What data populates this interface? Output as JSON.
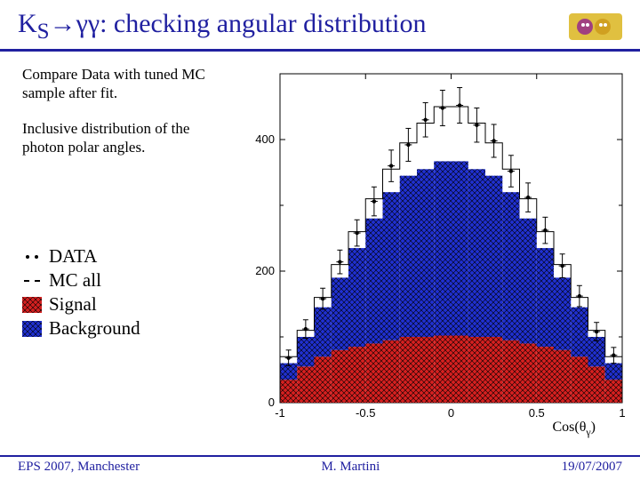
{
  "title_prefix": "K",
  "title_sub": "S",
  "title_arrow": "→γγ",
  "title_rest": ": checking angular distribution",
  "desc1": "Compare Data with tuned MC sample after fit.",
  "desc2": "Inclusive distribution of the photon polar angles.",
  "legend": {
    "data": "DATA",
    "mc": "MC all",
    "signal": "Signal",
    "bkg": "Background"
  },
  "footer": {
    "left": "EPS 2007, Manchester",
    "mid": "M. Martini",
    "right": "19/07/2007"
  },
  "xlabel": "Cos(θ",
  "xlabel_sub": "γ",
  "xlabel_close": ")",
  "chart_data": {
    "type": "bar",
    "xlabel": "Cos(θ_γ)",
    "ylabel": "",
    "xlim": [
      -1.0,
      1.0
    ],
    "ylim": [
      0,
      500
    ],
    "y_ticks": [
      0,
      200,
      400
    ],
    "x_ticks": [
      -1,
      -0.5,
      0,
      0.5,
      1
    ],
    "bin_edges": [
      -1.0,
      -0.9,
      -0.8,
      -0.7,
      -0.6,
      -0.5,
      -0.4,
      -0.3,
      -0.2,
      -0.1,
      0.0,
      0.1,
      0.2,
      0.3,
      0.4,
      0.5,
      0.6,
      0.7,
      0.8,
      0.9,
      1.0
    ],
    "series": [
      {
        "name": "Signal",
        "role": "stacked-bottom",
        "color": "#d62020",
        "values": [
          35,
          55,
          70,
          80,
          85,
          90,
          95,
          100,
          100,
          102,
          102,
          100,
          100,
          95,
          90,
          85,
          80,
          70,
          55,
          35
        ]
      },
      {
        "name": "Background",
        "role": "stacked-top",
        "color": "#2030d0",
        "values": [
          25,
          45,
          75,
          110,
          150,
          190,
          225,
          245,
          255,
          265,
          265,
          255,
          245,
          225,
          190,
          150,
          110,
          75,
          45,
          25
        ]
      },
      {
        "name": "MC all",
        "role": "step-line",
        "values": [
          70,
          110,
          160,
          210,
          260,
          310,
          355,
          395,
          425,
          450,
          450,
          425,
          395,
          355,
          310,
          260,
          210,
          160,
          110,
          70
        ]
      },
      {
        "name": "DATA",
        "role": "points-errors",
        "values": [
          68,
          112,
          158,
          214,
          258,
          306,
          360,
          392,
          430,
          448,
          452,
          422,
          398,
          352,
          312,
          262,
          208,
          162,
          108,
          72
        ],
        "errors": [
          12,
          14,
          16,
          18,
          20,
          22,
          24,
          25,
          26,
          27,
          27,
          26,
          25,
          24,
          22,
          20,
          18,
          16,
          14,
          12
        ]
      }
    ]
  }
}
